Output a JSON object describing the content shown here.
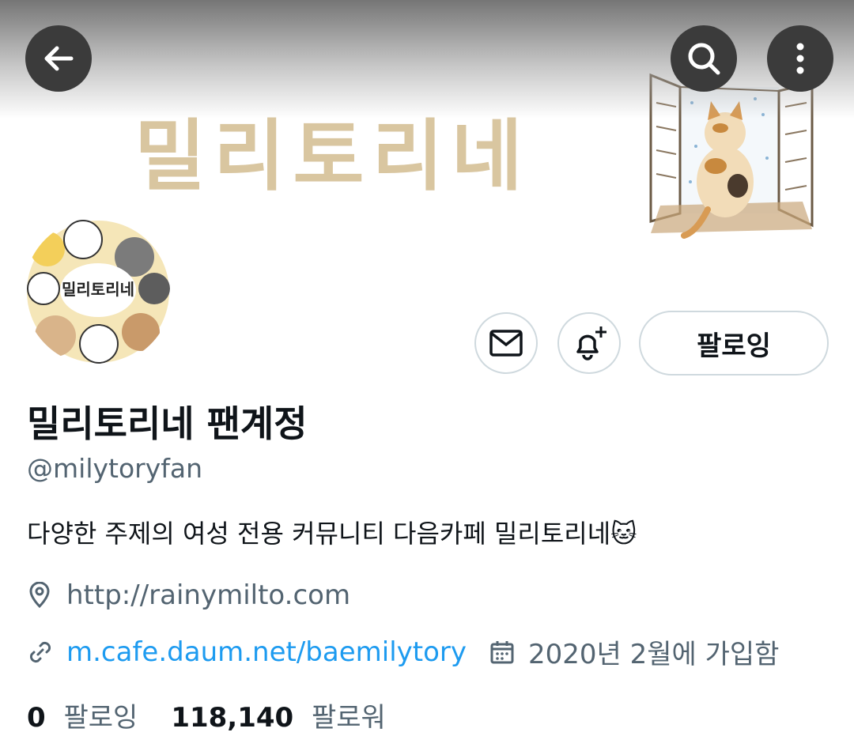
{
  "banner": {
    "title": "밀리토리네"
  },
  "header": {
    "back_icon": "arrow-left-icon",
    "search_icon": "search-icon",
    "more_icon": "more-vertical-icon"
  },
  "avatar": {
    "text": "밀리토리네"
  },
  "actions": {
    "follow_label": "팔로잉"
  },
  "profile": {
    "name": "밀리토리네 팬계정",
    "handle": "@milytoryfan",
    "bio": "다양한 주제의 여성 전용 커뮤니티 다음카페 밀리토리네🐱",
    "location": "http://rainymilto.com",
    "website": "m.cafe.daum.net/baemilytory",
    "joined": "2020년 2월에 가입함"
  },
  "stats": {
    "following_count": "0",
    "following_label": "팔로잉",
    "followers_count": "118,140",
    "followers_label": "팔로워"
  },
  "colors": {
    "link": "#1d9bf0",
    "muted": "#536471",
    "text": "#0f1419",
    "border": "#cfd9de"
  }
}
